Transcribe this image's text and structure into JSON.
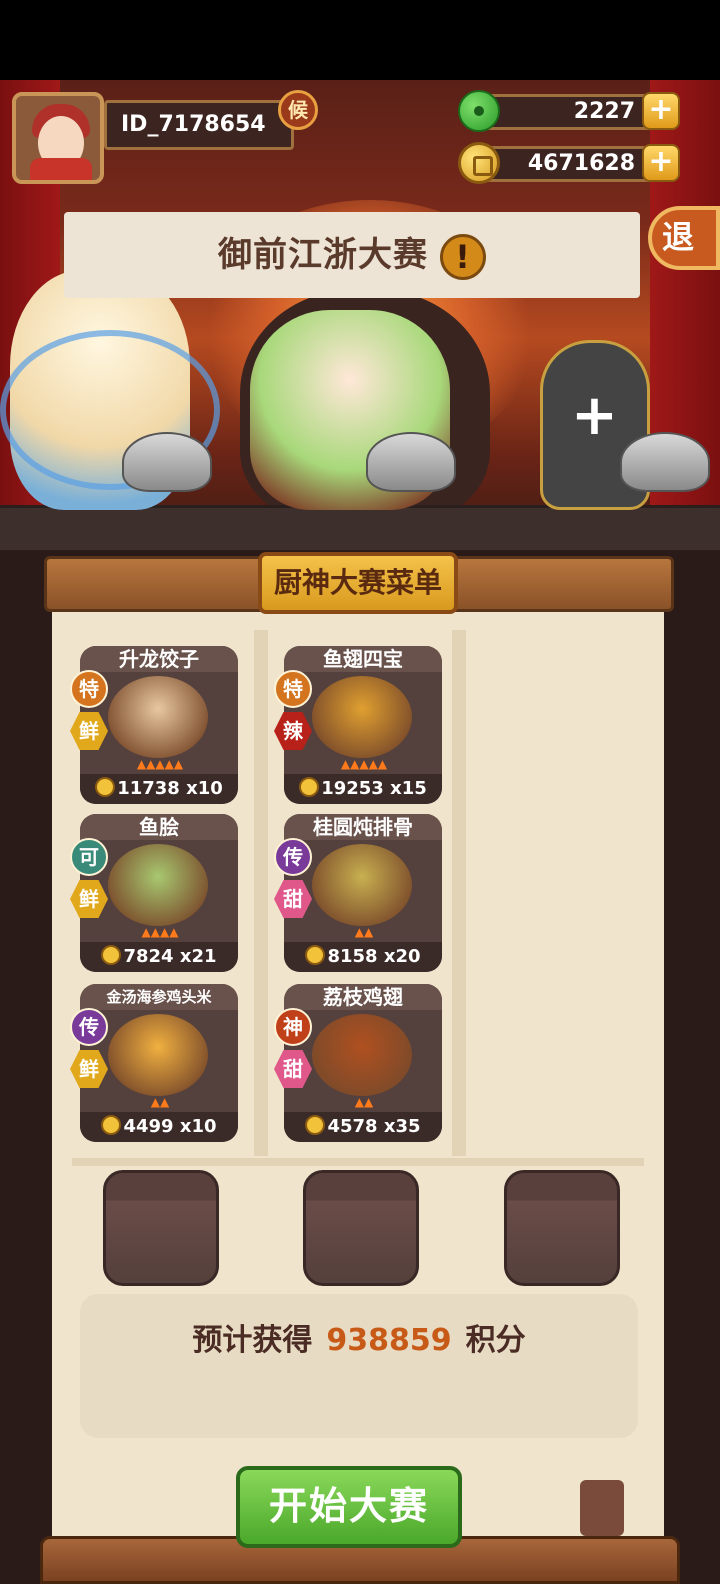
{
  "player": {
    "id": "ID_7178654",
    "rank_badge": "候"
  },
  "currencies": [
    {
      "name": "jade",
      "value": "2227",
      "plus": "+"
    },
    {
      "name": "coin",
      "value": "4671628",
      "plus": "+"
    }
  ],
  "exit_label": "退",
  "event": {
    "title": "御前江浙大赛",
    "alert_glyph": "!"
  },
  "empty_slot_glyph": "+",
  "menu": {
    "title": "厨神大赛菜单",
    "dishes": [
      {
        "name": "升龙饺子",
        "grade": "特",
        "taste": "鲜",
        "price": "11738",
        "qty": "x10",
        "flames": 5
      },
      {
        "name": "鱼翅四宝",
        "grade": "特",
        "taste": "辣",
        "price": "19253",
        "qty": "x15",
        "flames": 5
      },
      {
        "name": "鱼脍",
        "grade": "可",
        "taste": "鲜",
        "price": "7824",
        "qty": "x21",
        "flames": 4
      },
      {
        "name": "桂圆炖排骨",
        "grade": "传",
        "taste": "甜",
        "price": "8158",
        "qty": "x20",
        "flames": 2
      },
      {
        "name": "金汤海参鸡头米",
        "grade": "传",
        "taste": "鲜",
        "price": "4499",
        "qty": "x10",
        "flames": 2
      },
      {
        "name": "荔枝鸡翅",
        "grade": "神",
        "taste": "甜",
        "price": "4578",
        "qty": "x35",
        "flames": 2
      }
    ]
  },
  "score": {
    "prefix": "预计获得",
    "value": "938859",
    "suffix": "积分"
  },
  "start_button": "开始大赛",
  "colors": {
    "grade_special": "#d4741e",
    "grade_ok": "#3a8a7a",
    "grade_legend": "#7a3a9a",
    "grade_god": "#c0401a",
    "taste_fresh": "#e0a81a",
    "taste_spicy": "#b8201a",
    "taste_sweet": "#e0588a",
    "score_number": "#c85a18"
  }
}
